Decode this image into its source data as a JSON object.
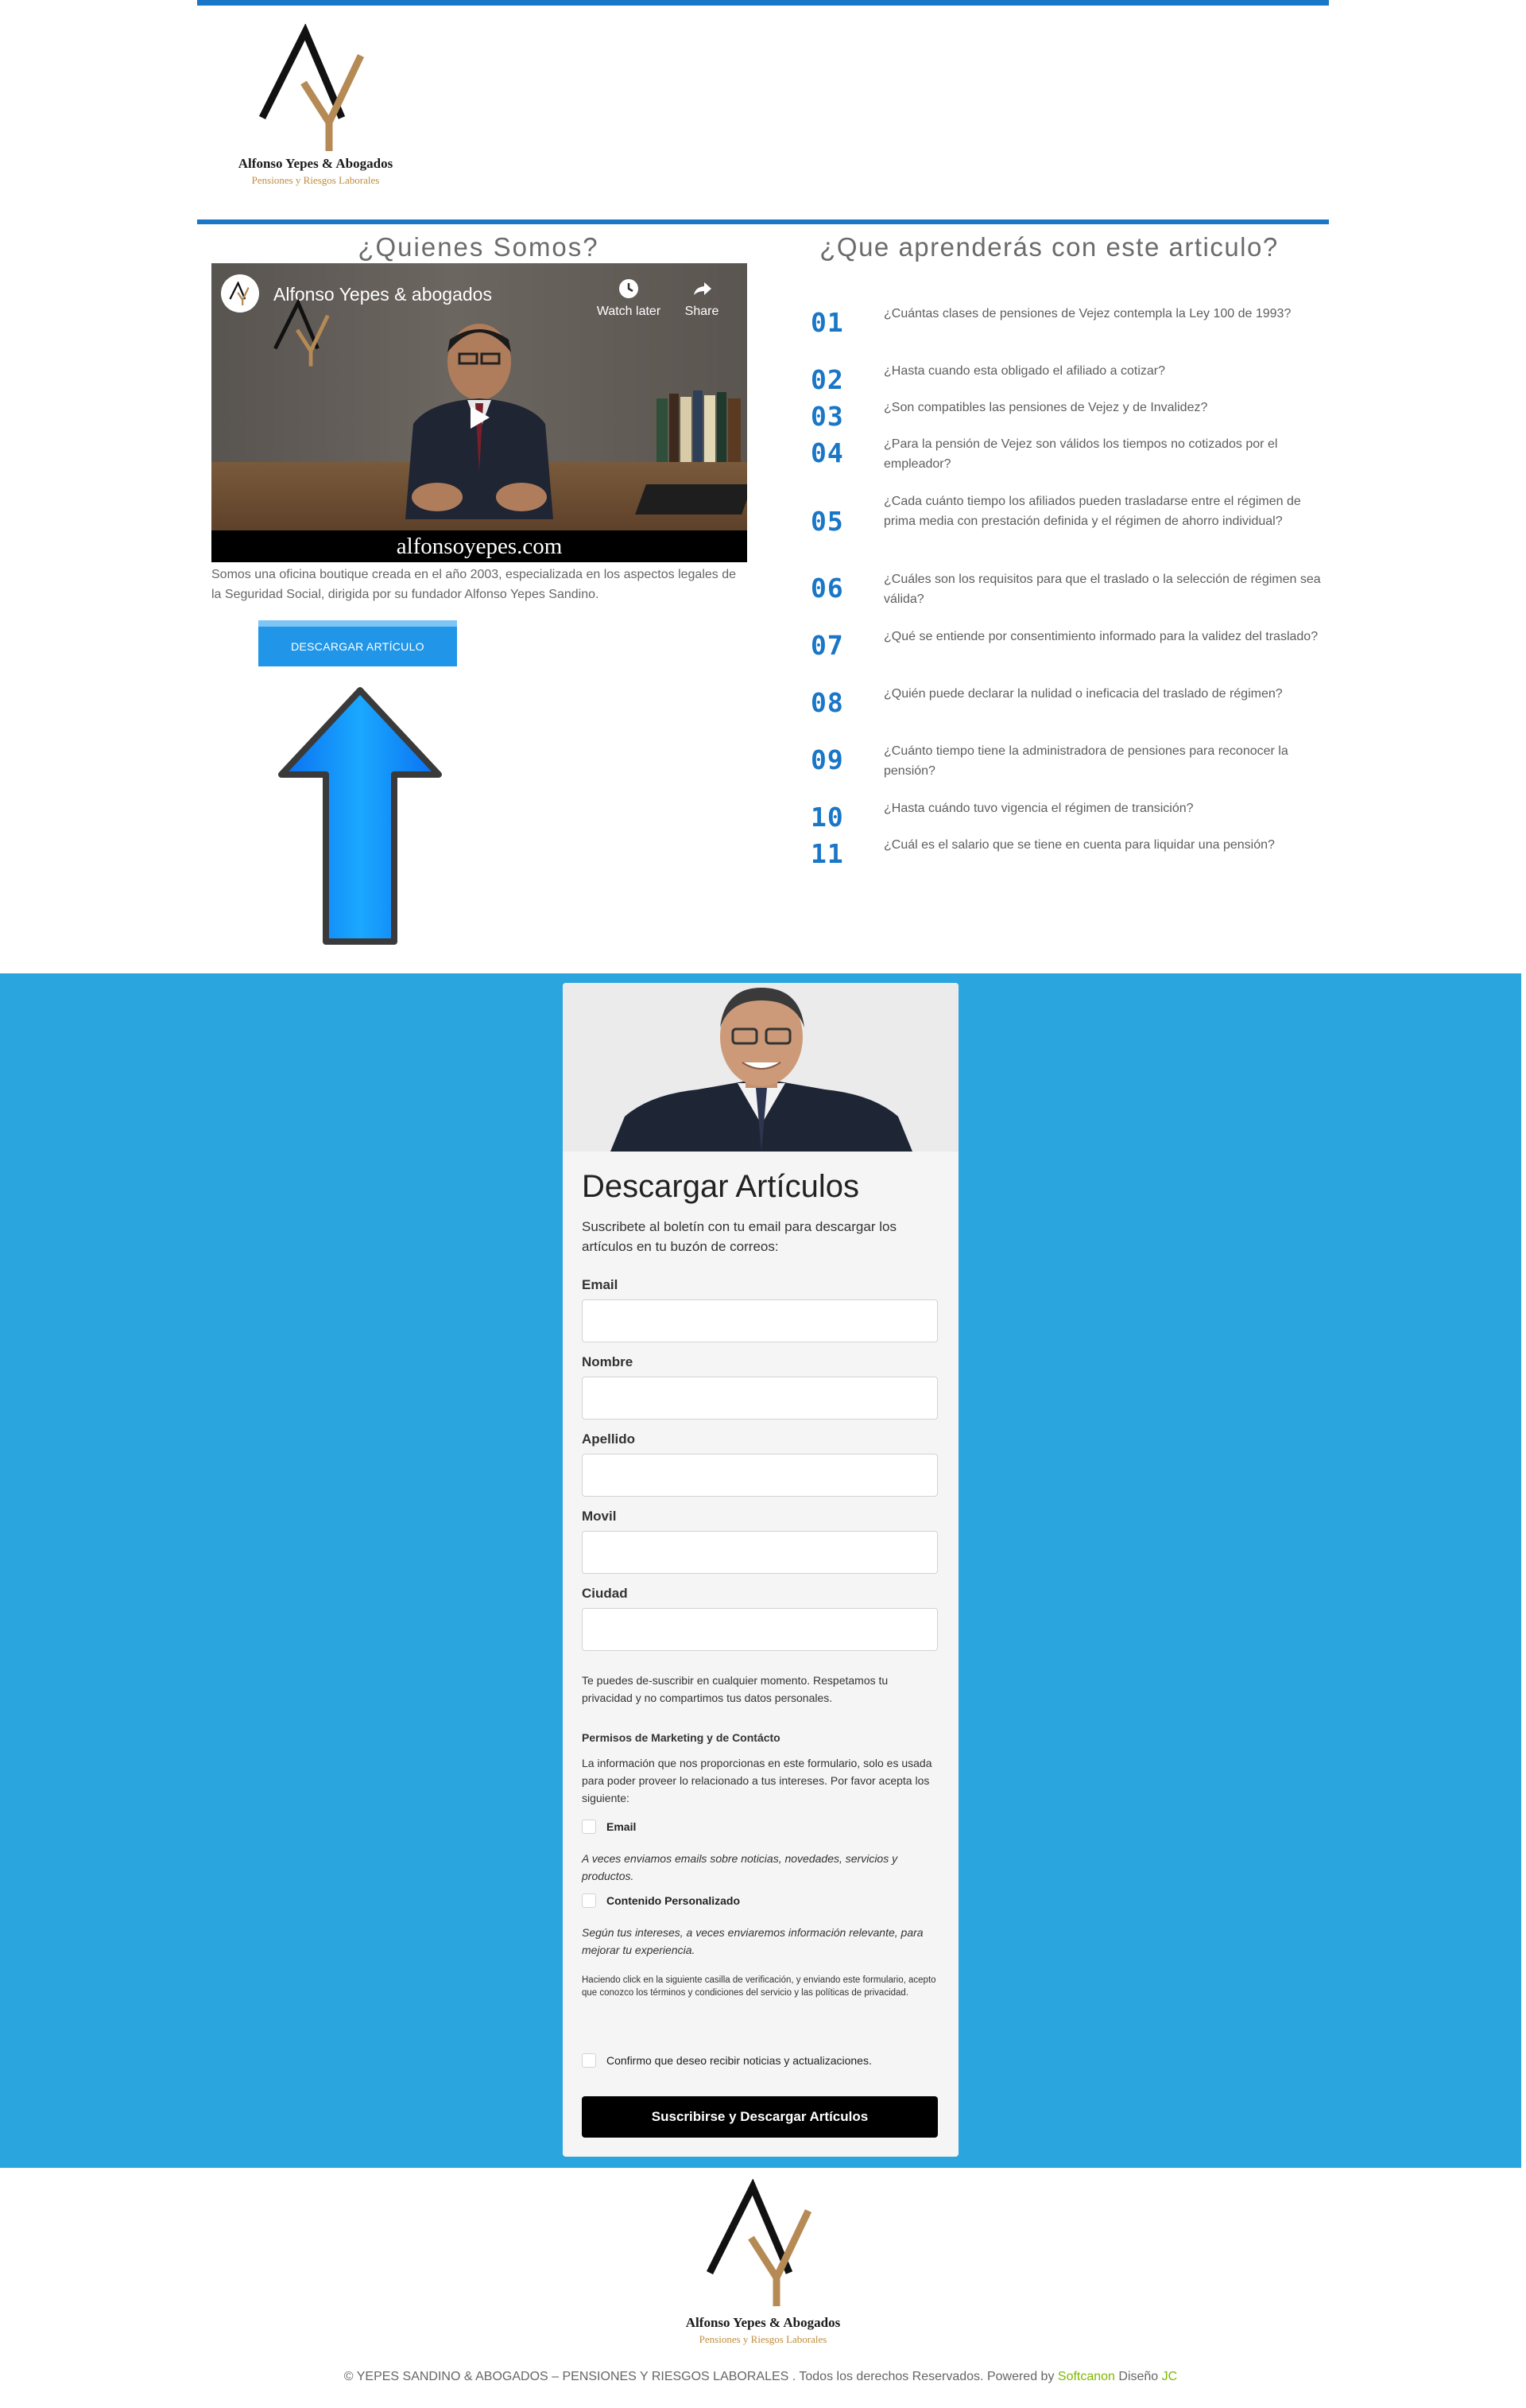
{
  "header": {
    "logo_name": "Alfonso Yepes & Abogados",
    "logo_subtitle": "Pensiones y Riesgos Laborales"
  },
  "about": {
    "heading": "¿Quienes Somos?",
    "video": {
      "channel_title": "Alfonso Yepes & abogados",
      "watch_later": "Watch later",
      "share": "Share",
      "url_banner": "alfonsoyepes.com"
    },
    "description": "Somos una oficina boutique creada en el año 2003, especializada en los aspectos legales de la Seguridad Social, dirigida por su fundador Alfonso Yepes Sandino.",
    "download_button": "DESCARGAR ARTÍCULO"
  },
  "learn": {
    "heading": "¿Que aprenderás con este articulo?",
    "questions": [
      {
        "num": "01",
        "text": "¿Cuántas clases de pensiones de Vejez contempla la Ley 100 de 1993?"
      },
      {
        "num": "02",
        "text": "¿Hasta cuando esta obligado el afiliado a cotizar?"
      },
      {
        "num": "03",
        "text": "¿Son compatibles las pensiones de Vejez y de Invalidez?"
      },
      {
        "num": "04",
        "text": "¿Para la pensión de Vejez son válidos los tiempos no cotizados por el empleador?"
      },
      {
        "num": "05",
        "text": "¿Cada cuánto tiempo los afiliados pueden trasladarse entre el régimen de prima media con prestación definida y el régimen de ahorro individual?"
      },
      {
        "num": "06",
        "text": "¿Cuáles son los requisitos para que el traslado o la selección de régimen sea válida?"
      },
      {
        "num": "07",
        "text": "¿Qué se entiende por consentimiento informado para la validez del traslado?"
      },
      {
        "num": "08",
        "text": "¿Quién puede declarar la nulidad o ineficacia del traslado de régimen?"
      },
      {
        "num": "09",
        "text": "¿Cuánto tiempo tiene la administradora de pensiones para reconocer la pensión?"
      },
      {
        "num": "10",
        "text": "¿Hasta cuándo tuvo vigencia el régimen de transición?"
      },
      {
        "num": "11",
        "text": "¿Cuál es el salario que se tiene en cuenta para liquidar una pensión?"
      }
    ]
  },
  "form": {
    "title": "Descargar Artículos",
    "intro": "Suscribete al boletín con tu email para descargar los artículos en tu buzón de correos:",
    "fields": [
      {
        "label": "Email"
      },
      {
        "label": "Nombre"
      },
      {
        "label": "Apellido"
      },
      {
        "label": "Movil"
      },
      {
        "label": "Ciudad"
      }
    ],
    "unsubscribe_note": "Te puedes de-suscribir en cualquier momento.  Respetamos tu privacidad y no compartimos tus datos personales.",
    "marketing_heading": "Permisos de Marketing y de Contácto",
    "marketing_text": "La información que nos proporcionas en este formulario, solo es usada para poder proveer lo relacionado a tus intereses.  Por favor acepta los siguiente:",
    "opt_email_label": "Email",
    "opt_email_desc": "A veces enviamos emails sobre noticias, novedades, servicios y productos.",
    "opt_content_label": "Contenido Personalizado",
    "opt_content_desc": "Según tus intereses, a veces enviaremos información relevante, para mejorar tu experiencia.",
    "terms_text": "Haciendo click en la siguiente casilla de verificación, y enviando este formulario, acepto que conozco los términos y condiciones del servicio y las políticas de privacidad.",
    "confirm_label": "Confirmo que deseo recibir noticias y actualizaciones.",
    "submit": "Suscribirse y Descargar Artículos"
  },
  "footer": {
    "logo_name": "Alfonso Yepes & Abogados",
    "logo_subtitle": "Pensiones y Riesgos Laborales",
    "copyright_pre": "©    YEPES SANDINO & ABOGADOS – PENSIONES Y RIESGOS LABORALES .  Todos los derechos Reservados. Powered by ",
    "softcanon": "Softcanon",
    "design_pre": " Diseño ",
    "jc": "JC"
  },
  "colors": {
    "brand_blue": "#1a76c6",
    "band_blue": "#2aa5de",
    "button_blue": "#2196e8",
    "gold": "#c08d3c",
    "green": "#7fb800"
  }
}
